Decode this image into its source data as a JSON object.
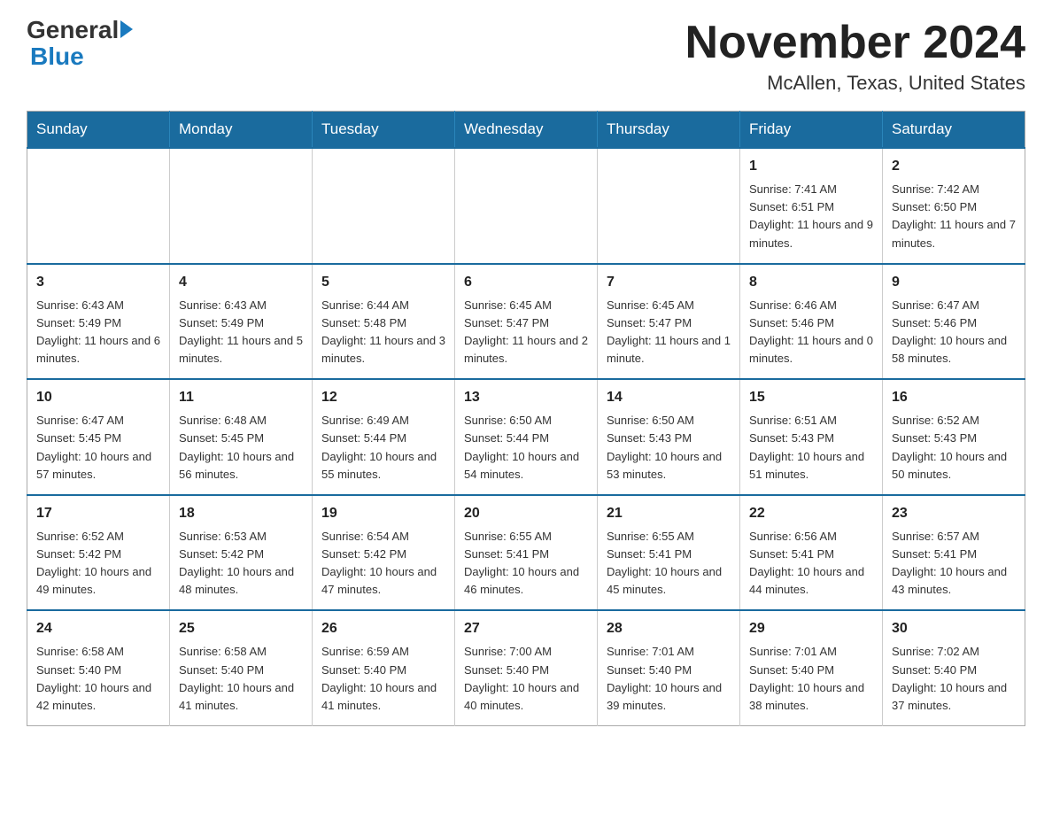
{
  "header": {
    "logo_general": "General",
    "logo_blue": "Blue",
    "month_title": "November 2024",
    "location": "McAllen, Texas, United States"
  },
  "weekdays": [
    "Sunday",
    "Monday",
    "Tuesday",
    "Wednesday",
    "Thursday",
    "Friday",
    "Saturday"
  ],
  "weeks": [
    [
      {
        "day": "",
        "info": ""
      },
      {
        "day": "",
        "info": ""
      },
      {
        "day": "",
        "info": ""
      },
      {
        "day": "",
        "info": ""
      },
      {
        "day": "",
        "info": ""
      },
      {
        "day": "1",
        "info": "Sunrise: 7:41 AM\nSunset: 6:51 PM\nDaylight: 11 hours and 9 minutes."
      },
      {
        "day": "2",
        "info": "Sunrise: 7:42 AM\nSunset: 6:50 PM\nDaylight: 11 hours and 7 minutes."
      }
    ],
    [
      {
        "day": "3",
        "info": "Sunrise: 6:43 AM\nSunset: 5:49 PM\nDaylight: 11 hours and 6 minutes."
      },
      {
        "day": "4",
        "info": "Sunrise: 6:43 AM\nSunset: 5:49 PM\nDaylight: 11 hours and 5 minutes."
      },
      {
        "day": "5",
        "info": "Sunrise: 6:44 AM\nSunset: 5:48 PM\nDaylight: 11 hours and 3 minutes."
      },
      {
        "day": "6",
        "info": "Sunrise: 6:45 AM\nSunset: 5:47 PM\nDaylight: 11 hours and 2 minutes."
      },
      {
        "day": "7",
        "info": "Sunrise: 6:45 AM\nSunset: 5:47 PM\nDaylight: 11 hours and 1 minute."
      },
      {
        "day": "8",
        "info": "Sunrise: 6:46 AM\nSunset: 5:46 PM\nDaylight: 11 hours and 0 minutes."
      },
      {
        "day": "9",
        "info": "Sunrise: 6:47 AM\nSunset: 5:46 PM\nDaylight: 10 hours and 58 minutes."
      }
    ],
    [
      {
        "day": "10",
        "info": "Sunrise: 6:47 AM\nSunset: 5:45 PM\nDaylight: 10 hours and 57 minutes."
      },
      {
        "day": "11",
        "info": "Sunrise: 6:48 AM\nSunset: 5:45 PM\nDaylight: 10 hours and 56 minutes."
      },
      {
        "day": "12",
        "info": "Sunrise: 6:49 AM\nSunset: 5:44 PM\nDaylight: 10 hours and 55 minutes."
      },
      {
        "day": "13",
        "info": "Sunrise: 6:50 AM\nSunset: 5:44 PM\nDaylight: 10 hours and 54 minutes."
      },
      {
        "day": "14",
        "info": "Sunrise: 6:50 AM\nSunset: 5:43 PM\nDaylight: 10 hours and 53 minutes."
      },
      {
        "day": "15",
        "info": "Sunrise: 6:51 AM\nSunset: 5:43 PM\nDaylight: 10 hours and 51 minutes."
      },
      {
        "day": "16",
        "info": "Sunrise: 6:52 AM\nSunset: 5:43 PM\nDaylight: 10 hours and 50 minutes."
      }
    ],
    [
      {
        "day": "17",
        "info": "Sunrise: 6:52 AM\nSunset: 5:42 PM\nDaylight: 10 hours and 49 minutes."
      },
      {
        "day": "18",
        "info": "Sunrise: 6:53 AM\nSunset: 5:42 PM\nDaylight: 10 hours and 48 minutes."
      },
      {
        "day": "19",
        "info": "Sunrise: 6:54 AM\nSunset: 5:42 PM\nDaylight: 10 hours and 47 minutes."
      },
      {
        "day": "20",
        "info": "Sunrise: 6:55 AM\nSunset: 5:41 PM\nDaylight: 10 hours and 46 minutes."
      },
      {
        "day": "21",
        "info": "Sunrise: 6:55 AM\nSunset: 5:41 PM\nDaylight: 10 hours and 45 minutes."
      },
      {
        "day": "22",
        "info": "Sunrise: 6:56 AM\nSunset: 5:41 PM\nDaylight: 10 hours and 44 minutes."
      },
      {
        "day": "23",
        "info": "Sunrise: 6:57 AM\nSunset: 5:41 PM\nDaylight: 10 hours and 43 minutes."
      }
    ],
    [
      {
        "day": "24",
        "info": "Sunrise: 6:58 AM\nSunset: 5:40 PM\nDaylight: 10 hours and 42 minutes."
      },
      {
        "day": "25",
        "info": "Sunrise: 6:58 AM\nSunset: 5:40 PM\nDaylight: 10 hours and 41 minutes."
      },
      {
        "day": "26",
        "info": "Sunrise: 6:59 AM\nSunset: 5:40 PM\nDaylight: 10 hours and 41 minutes."
      },
      {
        "day": "27",
        "info": "Sunrise: 7:00 AM\nSunset: 5:40 PM\nDaylight: 10 hours and 40 minutes."
      },
      {
        "day": "28",
        "info": "Sunrise: 7:01 AM\nSunset: 5:40 PM\nDaylight: 10 hours and 39 minutes."
      },
      {
        "day": "29",
        "info": "Sunrise: 7:01 AM\nSunset: 5:40 PM\nDaylight: 10 hours and 38 minutes."
      },
      {
        "day": "30",
        "info": "Sunrise: 7:02 AM\nSunset: 5:40 PM\nDaylight: 10 hours and 37 minutes."
      }
    ]
  ]
}
